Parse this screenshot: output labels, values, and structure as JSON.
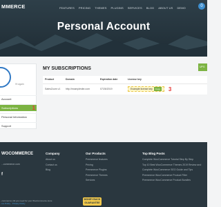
{
  "header": {
    "logo_text": "MMERCE",
    "nav": [
      "FEATURES",
      "PRICING",
      "THEMES",
      "PLUGINS",
      "SERVICES",
      "BLOG",
      "ABOUT US",
      "DEMO"
    ],
    "cart_count": "0"
  },
  "page_title": "Personal Account",
  "sidebar": {
    "greeting": "Hi again",
    "items": [
      {
        "label": "Account"
      },
      {
        "label": "Subscriptions",
        "active": true,
        "badge": "1"
      },
      {
        "label": "Personal Information"
      },
      {
        "label": "Support"
      }
    ]
  },
  "subscriptions": {
    "title": "MY SUBSCRIPTIONS",
    "upgrade_label": "UPG",
    "columns": [
      "Product",
      "Domain",
      "Expiration date",
      "License key"
    ],
    "rows": [
      {
        "product": "SalesZoom v1",
        "domain": "http://examplesite.com",
        "expiration": "07/26/2019",
        "license_key": "Example license key",
        "copy_label": "Copy",
        "badge": "3"
      }
    ]
  },
  "footer": {
    "logo": "WOCOMMERCE",
    "email": "...commerce.com",
    "company": {
      "title": "Company",
      "links": [
        "About us",
        "Contact us",
        "Blog"
      ]
    },
    "products": {
      "title": "Our Products",
      "links": [
        "Premmerce features",
        "Pricing",
        "Premmerce Plugins",
        "Premmerce Themes",
        "Services"
      ]
    },
    "blog": {
      "title": "Top Blog Posts",
      "links": [
        "Complete WooCommerce Tutorial Step By Step",
        "Top 10 Best WooCommerce Themes 2019 Review and",
        "Complete WooCommerce SEO Guide and Tips",
        "Premmerce WooCommerce Product Filter",
        "Premmerce WooCommerce Product Bundles"
      ]
    },
    "copyright": "...commerce | All you need for your WooCommerce store",
    "policy": "...ice Policy",
    "privacy": "Privacy Policy",
    "money_back_line1": "MONEY BACK",
    "money_back_line2": "GUARANTEE"
  },
  "colors": {
    "accent_green": "#7cb342",
    "brand_blue": "#2f78c4",
    "footer_bg": "#2a373f",
    "marker_red": "#e53935"
  }
}
